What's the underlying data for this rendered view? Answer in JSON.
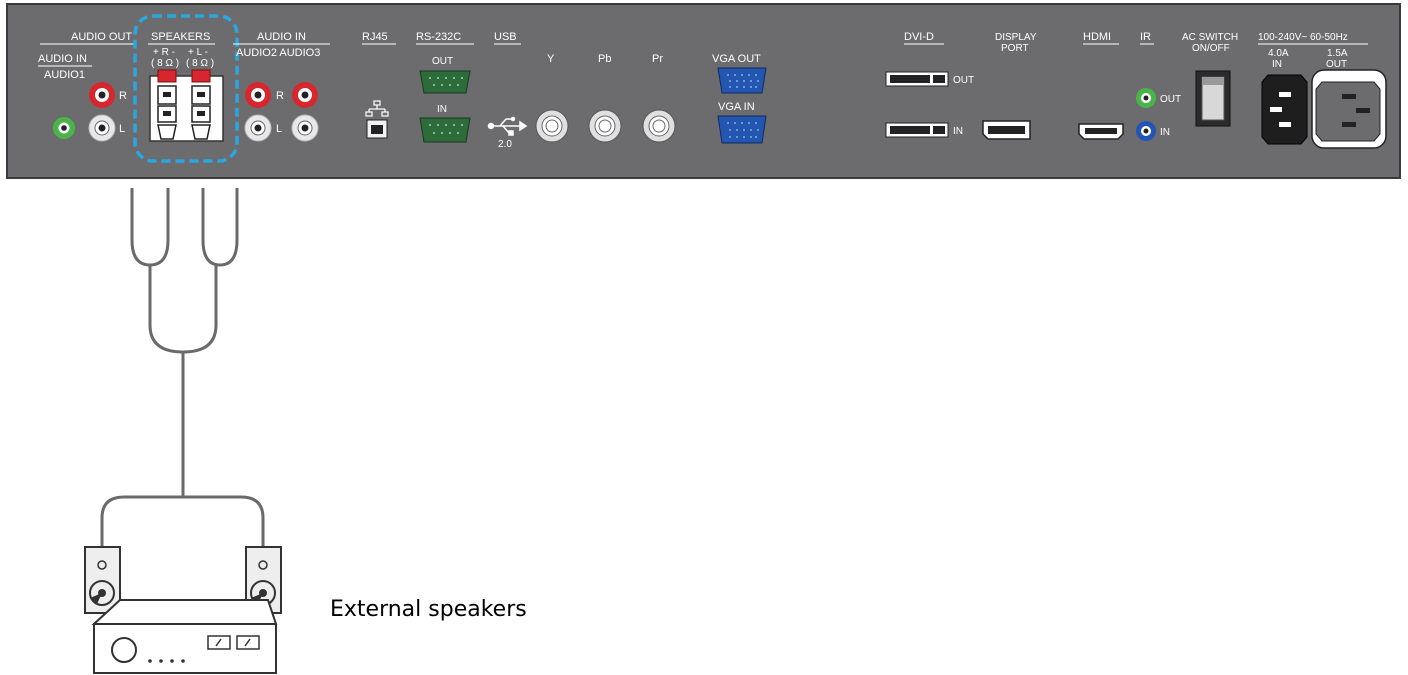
{
  "panel": {
    "audio_out": "AUDIO OUT",
    "audio_in_1": "AUDIO IN",
    "audio1": "AUDIO1",
    "speakers": "SPEAKERS",
    "spk_r": "+ R -",
    "spk_l": "+ L -",
    "spk_ohm_r": "( 8 Ω )",
    "spk_ohm_l": "( 8 Ω )",
    "audio_in_23": "AUDIO IN",
    "audio2_audio3": "AUDIO2  AUDIO3",
    "r_label_1": "R",
    "l_label_1": "L",
    "r_label_2": "R",
    "l_label_2": "L",
    "rj45": "RJ45",
    "rs232c": "RS-232C",
    "rs_out": "OUT",
    "rs_in": "IN",
    "usb": "USB",
    "usb_ver": "2.0",
    "y": "Y",
    "pb": "Pb",
    "pr": "Pr",
    "vga_out": "VGA OUT",
    "vga_in": "VGA IN",
    "dvi_d": "DVI-D",
    "dvi_out": "OUT",
    "dvi_in": "IN",
    "display_port_1": "DISPLAY",
    "display_port_2": "PORT",
    "hdmi": "HDMI",
    "ir": "IR",
    "ir_out": "OUT",
    "ir_in": "IN",
    "ac_switch_1": "AC SWITCH",
    "ac_switch_2": "ON/OFF",
    "power_rating": "100-240V~ 60-50Hz",
    "in_current": "4.0A",
    "in_label": "IN",
    "out_current": "1.5A",
    "out_label": "OUT"
  },
  "caption": "External speakers",
  "colors": {
    "panel": "#6c6c6e",
    "highlight": "#2aa7e0",
    "cable": "#6a6a6a",
    "red_jack": "#d7262d",
    "green_jack": "#49b548",
    "blue_jack": "#2255b5",
    "serial": "#2e6b3a",
    "vga": "#2356b0"
  }
}
